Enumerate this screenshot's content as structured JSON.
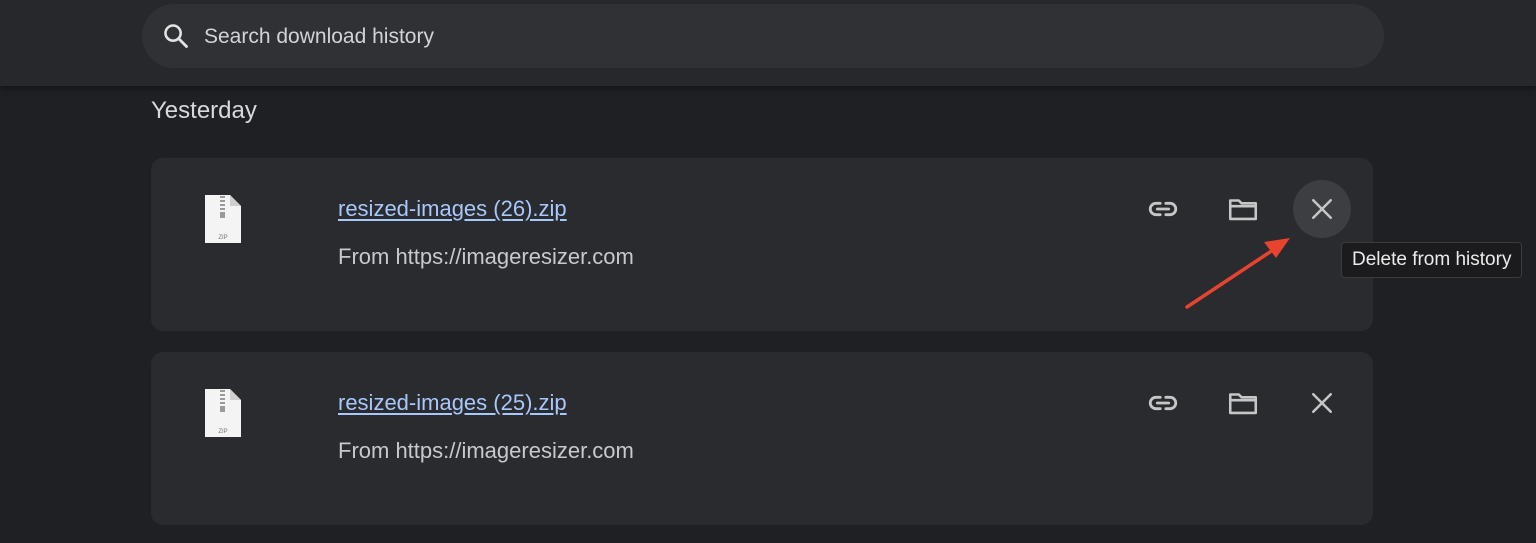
{
  "search": {
    "placeholder": "Search download history",
    "icon": "search-icon"
  },
  "section": {
    "title": "Yesterday"
  },
  "downloads": [
    {
      "filename": "resized-images (26).zip",
      "source": "From https://imageresizer.com",
      "file_icon": "zip-file-icon",
      "file_icon_label": "ZIP",
      "actions": [
        "copy-link-icon",
        "folder-icon",
        "close-icon"
      ]
    },
    {
      "filename": "resized-images (25).zip",
      "source": "From https://imageresizer.com",
      "file_icon": "zip-file-icon",
      "file_icon_label": "ZIP",
      "actions": [
        "copy-link-icon",
        "folder-icon",
        "close-icon"
      ]
    }
  ],
  "tooltip": {
    "text": "Delete from history"
  },
  "colors": {
    "background": "#1f2023",
    "card": "#2a2b2f",
    "link": "#a8c7fa",
    "annotation_arrow": "#e8432e"
  }
}
